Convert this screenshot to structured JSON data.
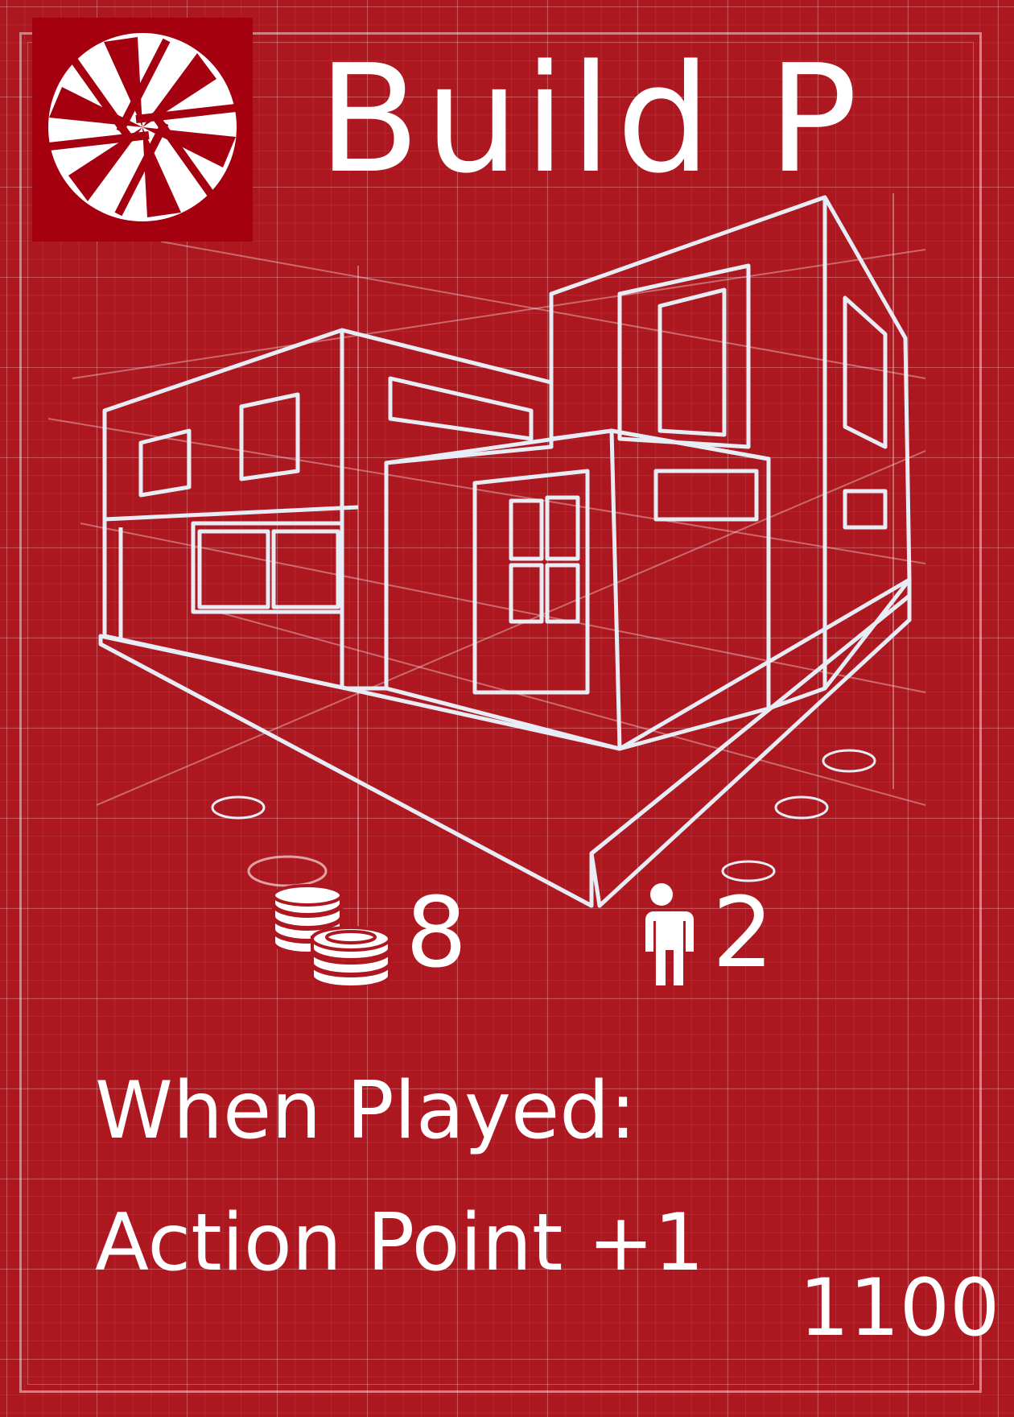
{
  "card": {
    "title": "Build P",
    "icons": {
      "logo": "camera-aperture-icon",
      "cost": "coin-stack-icon",
      "workers": "person-icon"
    },
    "cost": "8",
    "workers": "2",
    "effect": {
      "trigger": "When Played:",
      "text": "Action Point +1"
    },
    "code": "1100"
  },
  "colors": {
    "background": "#ad1820",
    "logo_bg": "#a40010",
    "lines": "#ffffff"
  }
}
